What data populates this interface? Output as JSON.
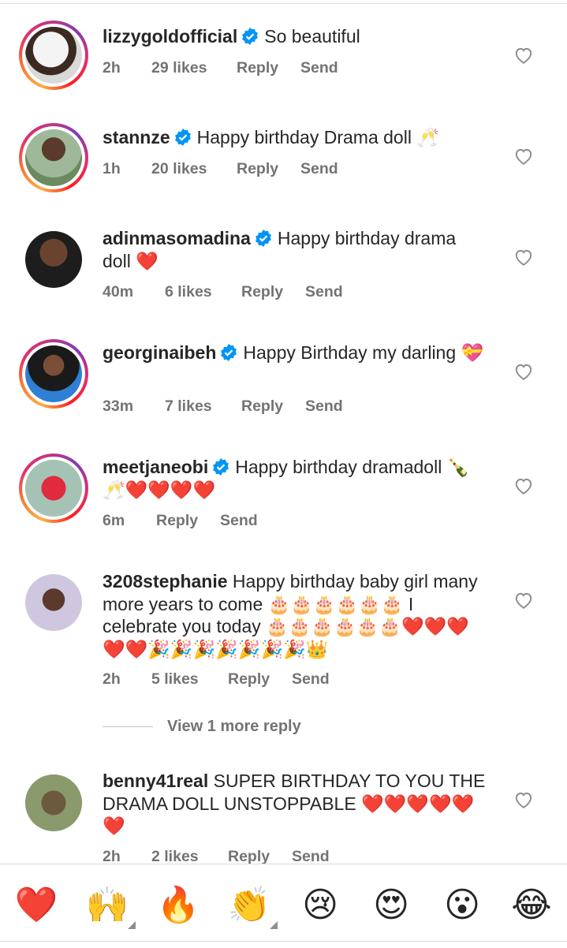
{
  "comments": [
    {
      "username": "lizzygoldofficial",
      "verified": true,
      "text": "So beautiful",
      "time": "2h",
      "likes": "29 likes",
      "reply": "Reply",
      "send": "Send"
    },
    {
      "username": "stannze",
      "verified": true,
      "text": "Happy birthday Drama doll 🥂",
      "time": "1h",
      "likes": "20 likes",
      "reply": "Reply",
      "send": "Send"
    },
    {
      "username": "adinmasomadina",
      "verified": true,
      "text": "Happy birthday drama doll ❤️",
      "time": "40m",
      "likes": "6 likes",
      "reply": "Reply",
      "send": "Send"
    },
    {
      "username": "georginaibeh",
      "verified": true,
      "text": "Happy Birthday my darling 💝",
      "time": "33m",
      "likes": "7 likes",
      "reply": "Reply",
      "send": "Send"
    },
    {
      "username": "meetjaneobi",
      "verified": true,
      "text": "Happy birthday dramadoll 🍾🥂❤️❤️❤️❤️",
      "time": "6m",
      "likes": "",
      "reply": "Reply",
      "send": "Send"
    },
    {
      "username": "3208stephanie",
      "verified": false,
      "text": "Happy birthday baby girl many more years to come 🎂🎂🎂🎂🎂🎂 I celebrate you today 🎂🎂🎂🎂🎂🎂❤️❤️❤️❤️❤️🎉🎉🎉🎉🎉🎉🎉👑",
      "time": "2h",
      "likes": "5 likes",
      "reply": "Reply",
      "send": "Send"
    },
    {
      "username": "benny41real",
      "verified": false,
      "text": "SUPER BIRTHDAY TO YOU  THE DRAMA DOLL UNSTOPPABLE ❤️❤️❤️❤️❤️❤️",
      "time": "2h",
      "likes": "2 likes",
      "reply": "Reply",
      "send": "Send"
    }
  ],
  "view_more": "View 1 more reply",
  "reactions": [
    "❤️",
    "🙌",
    "🔥",
    "👏",
    "😢",
    "😍",
    "😮",
    "😂"
  ],
  "colors": {
    "text": "#262626",
    "meta": "#737373",
    "verified": "#0095f6",
    "heart": "#e0162b"
  }
}
